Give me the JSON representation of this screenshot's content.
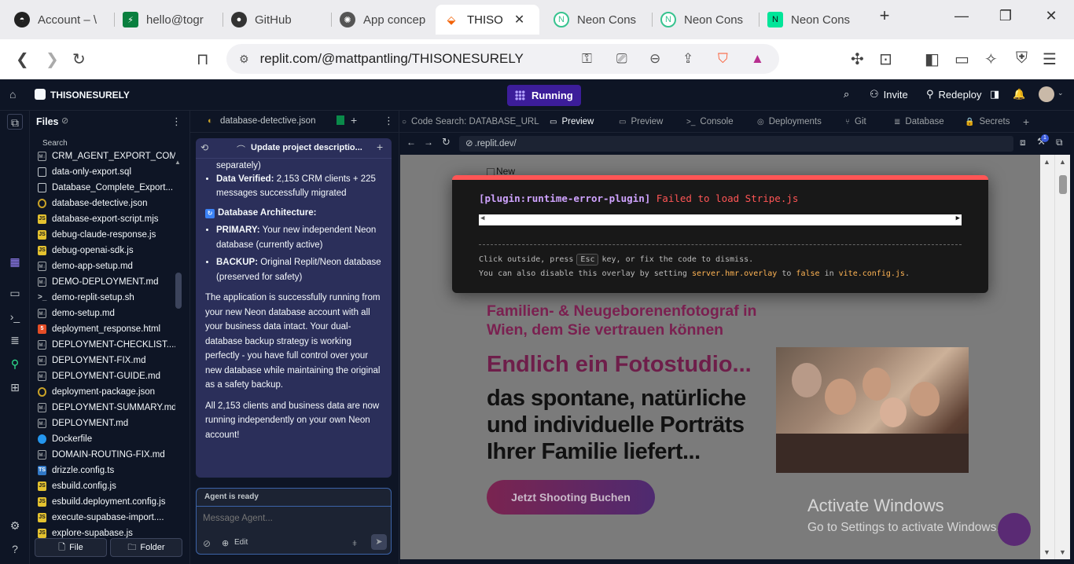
{
  "browser": {
    "tabs": [
      {
        "label": "Account – \\",
        "color": "#222"
      },
      {
        "label": "hello@togr",
        "color": "#0a7f3f"
      },
      {
        "label": "GitHub",
        "color": "#222"
      },
      {
        "label": "App concep",
        "color": "#222"
      },
      {
        "label": "THISO",
        "color": "#f26207"
      },
      {
        "label": "Neon Cons",
        "color": "#37c38f"
      },
      {
        "label": "Neon Cons",
        "color": "#37c38f"
      },
      {
        "label": "Neon Cons",
        "color": "#00e599"
      }
    ],
    "url": "replit.com/@mattpantling/THISONESURELY",
    "new_tab": "+"
  },
  "replit": {
    "project_name": "THISONESURELY",
    "run_status": "Running",
    "invite_label": "Invite",
    "redeploy_label": "Redeploy"
  },
  "files": {
    "title": "Files",
    "search_label": "Search",
    "items": [
      {
        "name": "CRM_AGENT_EXPORT_COM...",
        "type": "md"
      },
      {
        "name": "data-only-export.sql",
        "type": "sql"
      },
      {
        "name": "Database_Complete_Export...",
        "type": "doc"
      },
      {
        "name": "database-detective.json",
        "type": "json"
      },
      {
        "name": "database-export-script.mjs",
        "type": "js"
      },
      {
        "name": "debug-claude-response.js",
        "type": "js"
      },
      {
        "name": "debug-openai-sdk.js",
        "type": "js"
      },
      {
        "name": "demo-app-setup.md",
        "type": "md"
      },
      {
        "name": "DEMO-DEPLOYMENT.md",
        "type": "md"
      },
      {
        "name": "demo-replit-setup.sh",
        "type": "sh"
      },
      {
        "name": "demo-setup.md",
        "type": "md"
      },
      {
        "name": "deployment_response.html",
        "type": "html"
      },
      {
        "name": "DEPLOYMENT-CHECKLIST....",
        "type": "md"
      },
      {
        "name": "DEPLOYMENT-FIX.md",
        "type": "md"
      },
      {
        "name": "DEPLOYMENT-GUIDE.md",
        "type": "md"
      },
      {
        "name": "deployment-package.json",
        "type": "json"
      },
      {
        "name": "DEPLOYMENT-SUMMARY.md",
        "type": "md"
      },
      {
        "name": "DEPLOYMENT.md",
        "type": "md"
      },
      {
        "name": "Dockerfile",
        "type": "docker"
      },
      {
        "name": "DOMAIN-ROUTING-FIX.md",
        "type": "md"
      },
      {
        "name": "drizzle.config.ts",
        "type": "ts"
      },
      {
        "name": "esbuild.config.js",
        "type": "js"
      },
      {
        "name": "esbuild.deployment.config.js",
        "type": "js"
      },
      {
        "name": "execute-supabase-import....",
        "type": "js"
      },
      {
        "name": "explore-supabase.js",
        "type": "js"
      }
    ],
    "new_file": "File",
    "new_folder": "Folder"
  },
  "agent": {
    "file_tab": "database-detective.json",
    "thread_title": "Update project descriptio...",
    "msg_top": "separately)",
    "verified_label": "Data Verified:",
    "verified_text": "2,153 CRM clients + 225 messages successfully migrated",
    "arch_title": "Database Architecture:",
    "primary_label": "PRIMARY:",
    "primary_text": "Your new independent Neon database (currently active)",
    "backup_label": "BACKUP:",
    "backup_text": "Original Replit/Neon database (preserved for safety)",
    "para1": "The application is successfully running from your new Neon database account with all your business data intact. Your dual-database backup strategy is working perfectly - you have full control over your new database while maintaining the original as a safety backup.",
    "para2": "All 2,153 clients and business data are now running independently on your own Neon account!",
    "status": "Agent is ready",
    "placeholder": "Message Agent...",
    "edit_label": "Edit"
  },
  "panes": {
    "tabs": [
      {
        "label": "Code Search: DATABASE_URL",
        "icon": "○"
      },
      {
        "label": "Preview",
        "icon": "▭"
      },
      {
        "label": "Preview",
        "icon": "▭"
      },
      {
        "label": "Console",
        "icon": ">_"
      },
      {
        "label": "Deployments",
        "icon": "◎"
      },
      {
        "label": "Git",
        "icon": "⑂"
      },
      {
        "label": "Database",
        "icon": "≣"
      },
      {
        "label": "Secrets",
        "icon": "🔒"
      }
    ],
    "preview_url": ".replit.dev/"
  },
  "preview": {
    "img_alt": "New",
    "error_plugin": "[plugin:runtime-error-plugin]",
    "error_msg": "Failed to load Stripe.js",
    "tip1_a": "Click outside, press",
    "tip1_key": "Esc",
    "tip1_b": "key, or fix the code to dismiss.",
    "tip2_a": "You can also disable this overlay by setting",
    "tip2_setting": "server.hmr.overlay",
    "tip2_to": "to",
    "tip2_false": "false",
    "tip2_in": "in",
    "tip2_file": "vite.config.js",
    "tip2_end": ".",
    "headline": "Familien- & Neugeborenenfotograf in Wien, dem Sie vertrauen können",
    "heading2": "Endlich ein Fotostudio...",
    "heading3": "das spontane, natürliche und individuelle Porträts Ihrer Familie liefert...",
    "cta": "Jetzt Shooting Buchen",
    "watermark_title": "Activate Windows",
    "watermark_sub": "Go to Settings to activate Windows."
  }
}
